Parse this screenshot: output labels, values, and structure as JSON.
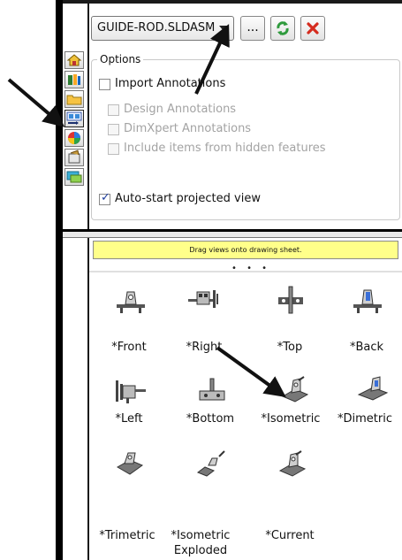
{
  "toolbar": {
    "document_dropdown": "GUIDE-ROD.SLDASM",
    "browse_label": "...",
    "refresh_icon": "refresh-icon",
    "close_icon": "close-icon",
    "accent_refresh": "#2e9a3c",
    "accent_close": "#d52b1e"
  },
  "options": {
    "title": "Options",
    "items": [
      {
        "label": "Import Annotations",
        "checked": false,
        "enabled": true
      },
      {
        "label": "Design Annotations",
        "checked": false,
        "enabled": false
      },
      {
        "label": "DimXpert Annotations",
        "checked": false,
        "enabled": false
      },
      {
        "label": "Include items from hidden features",
        "checked": false,
        "enabled": false
      },
      {
        "label": "Auto-start projected view",
        "checked": true,
        "enabled": true
      }
    ]
  },
  "palette": {
    "banner_text": "Drag views onto drawing sheet.",
    "banner_color": "#ffff8a",
    "views": [
      {
        "label": "*Front",
        "icon": "front-view-icon"
      },
      {
        "label": "*Right",
        "icon": "right-view-icon"
      },
      {
        "label": "*Top",
        "icon": "top-view-icon"
      },
      {
        "label": "*Back",
        "icon": "back-view-icon"
      },
      {
        "label": "*Left",
        "icon": "left-view-icon"
      },
      {
        "label": "*Bottom",
        "icon": "bottom-view-icon"
      },
      {
        "label": "*Isometric",
        "icon": "isometric-view-icon"
      },
      {
        "label": "*Dimetric",
        "icon": "dimetric-view-icon"
      },
      {
        "label": "*Trimetric",
        "icon": "trimetric-view-icon"
      },
      {
        "label": "*Isometric Exploded",
        "icon": "isometric-exploded-view-icon"
      },
      {
        "label": "*Current",
        "icon": "current-view-icon"
      }
    ]
  },
  "task_pane_icons": [
    "home-icon",
    "design-library-icon",
    "file-explorer-icon",
    "view-palette-icon",
    "appearances-icon",
    "custom-properties-icon",
    "forum-icon"
  ]
}
